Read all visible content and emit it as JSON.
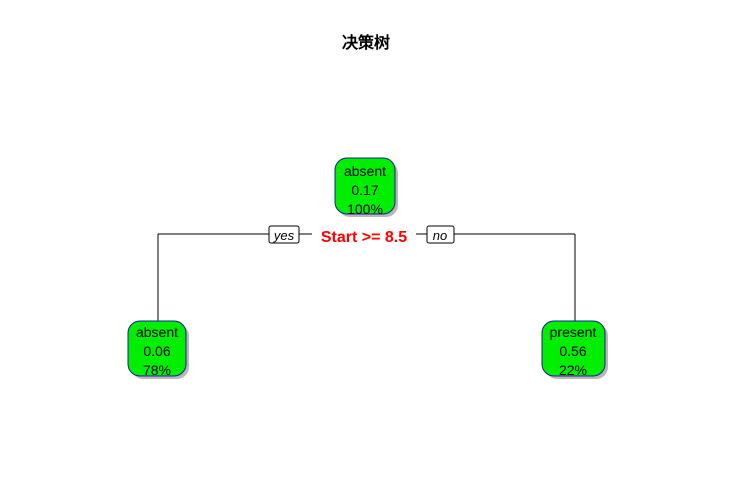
{
  "title": "决策树",
  "tree": {
    "root": {
      "class": "absent",
      "prob": "0.17",
      "pct": "100%"
    },
    "split": "Start >= 8.5",
    "yes_label": "yes",
    "no_label": "no",
    "left": {
      "class": "absent",
      "prob": "0.06",
      "pct": "78%"
    },
    "right": {
      "class": "present",
      "prob": "0.56",
      "pct": "22%"
    }
  },
  "colors": {
    "node_fill": "#00ee00",
    "node_border": "#1a1aa0",
    "node_shadow": "#b8b8b8",
    "split_text": "#ff0000",
    "edge": "#000000"
  }
}
